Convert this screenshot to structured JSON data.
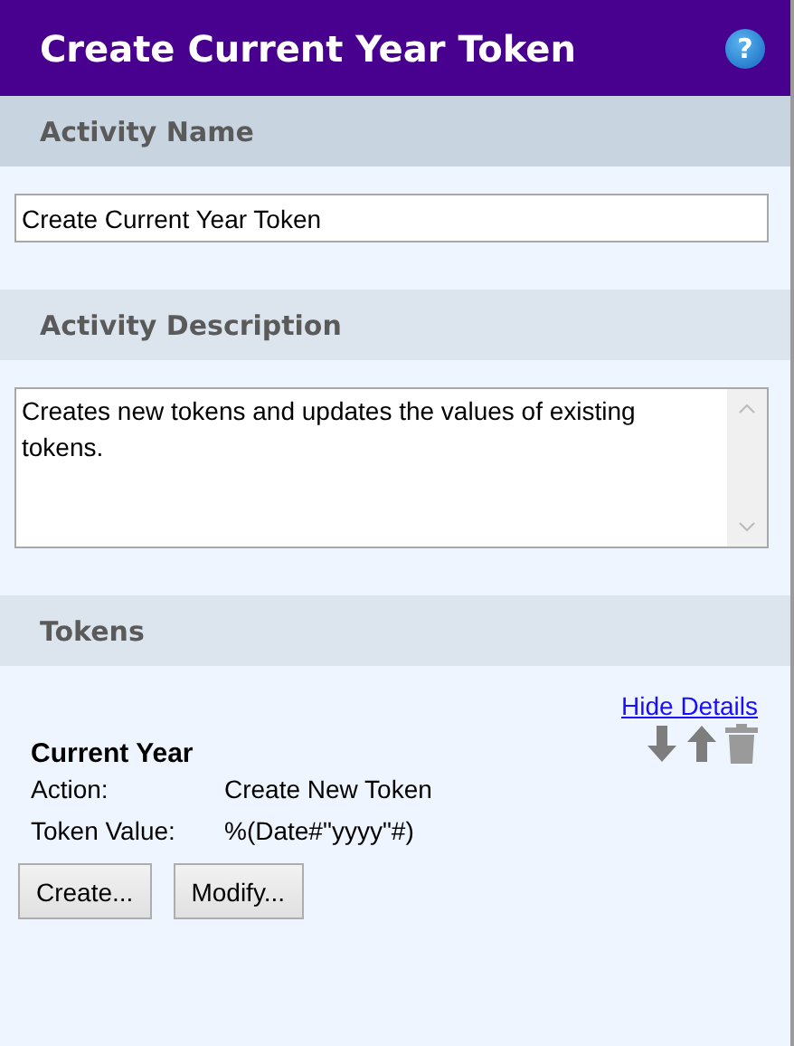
{
  "header": {
    "title": "Create Current Year Token",
    "help": "?"
  },
  "sections": [
    {
      "kind": "name",
      "title": "Activity Name",
      "value": "Create Current Year Token"
    },
    {
      "kind": "description",
      "title": "Activity Description",
      "value": "Creates new tokens and updates the values of existing tokens."
    },
    {
      "kind": "tokens",
      "title": "Tokens",
      "toggle_link": "Hide Details",
      "tokens": [
        {
          "name": "Current Year",
          "details": [
            {
              "label": "Action:",
              "value": "Create New Token"
            },
            {
              "label": "Token Value:",
              "value": "%(Date#\"yyyy\"#)"
            }
          ]
        }
      ],
      "buttons": [
        "Create...",
        "Modify..."
      ]
    }
  ]
}
